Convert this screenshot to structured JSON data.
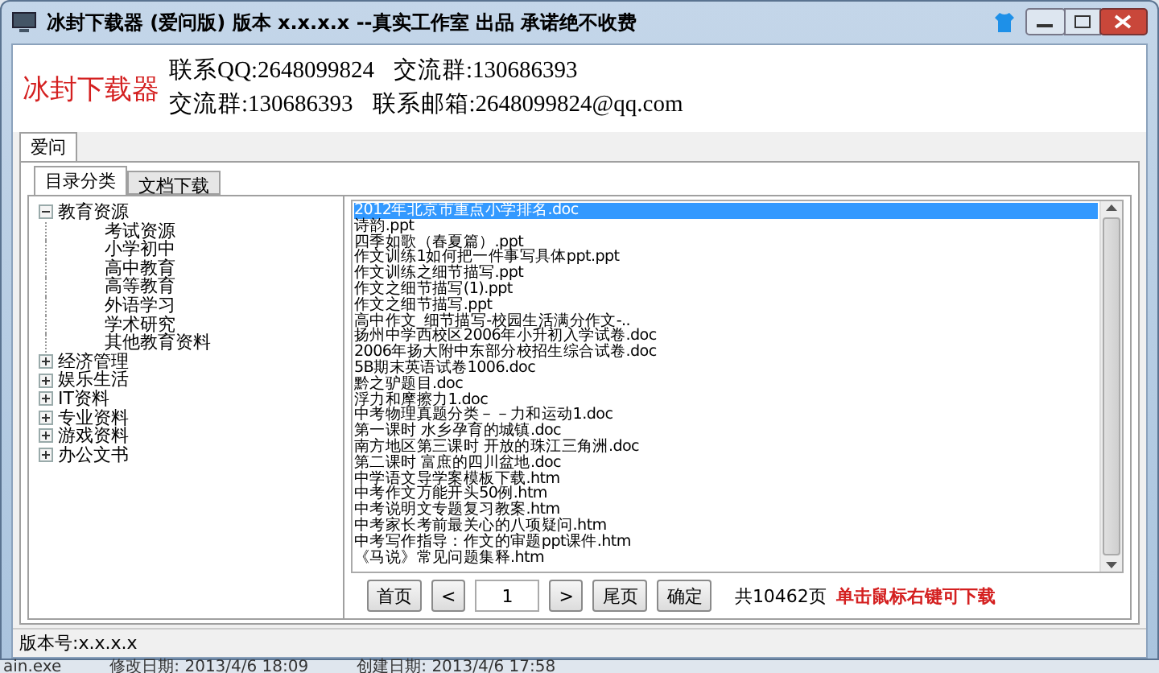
{
  "window": {
    "title": "冰封下载器 (爱问版)  版本 x.x.x.x --真实工作室 出品  承诺绝不收费"
  },
  "header": {
    "brand": "冰封下载器",
    "lines": [
      [
        "联系QQ:2648099824",
        "交流群:130686393"
      ],
      [
        "交流群:130686393",
        "联系邮箱:2648099824@qq.com"
      ]
    ]
  },
  "outer_tabs": [
    {
      "label": "爱问",
      "selected": true
    }
  ],
  "inner_tabs": [
    {
      "label": "目录分类",
      "selected": true
    },
    {
      "label": "文档下载",
      "selected": false
    }
  ],
  "tree": [
    {
      "label": "教育资源",
      "expanded": true,
      "children": [
        {
          "label": "考试资源"
        },
        {
          "label": "小学初中"
        },
        {
          "label": "高中教育"
        },
        {
          "label": "高等教育"
        },
        {
          "label": "外语学习"
        },
        {
          "label": "学术研究"
        },
        {
          "label": "其他教育资料"
        }
      ]
    },
    {
      "label": "经济管理",
      "expanded": false
    },
    {
      "label": "娱乐生活",
      "expanded": false
    },
    {
      "label": "IT资料",
      "expanded": false
    },
    {
      "label": "专业资料",
      "expanded": false
    },
    {
      "label": "游戏资料",
      "expanded": false
    },
    {
      "label": "办公文书",
      "expanded": false
    }
  ],
  "files": [
    {
      "name": "2012年北京市重点小学排名.doc",
      "selected": true
    },
    {
      "name": "诗韵.ppt",
      "selected": false
    },
    {
      "name": "四季如歌（春夏篇）.ppt",
      "selected": false
    },
    {
      "name": "作文训练1如何把一件事写具体ppt.ppt",
      "selected": false
    },
    {
      "name": "作文训练之细节描写.ppt",
      "selected": false
    },
    {
      "name": "作文之细节描写(1).ppt",
      "selected": false
    },
    {
      "name": "作文之细节描写.ppt",
      "selected": false
    },
    {
      "name": "高中作文_细节描写-校园生活满分作文-..",
      "selected": false
    },
    {
      "name": "扬州中学西校区2006年小升初入学试卷.doc",
      "selected": false
    },
    {
      "name": "2006年扬大附中东部分校招生综合试卷.doc",
      "selected": false
    },
    {
      "name": "5B期末英语试卷1006.doc",
      "selected": false
    },
    {
      "name": "黔之驴题目.doc",
      "selected": false
    },
    {
      "name": "浮力和摩擦力1.doc",
      "selected": false
    },
    {
      "name": "中考物理真题分类－－力和运动1.doc",
      "selected": false
    },
    {
      "name": "第一课时  水乡孕育的城镇.doc",
      "selected": false
    },
    {
      "name": "南方地区第三课时  开放的珠江三角洲.doc",
      "selected": false
    },
    {
      "name": "第二课时  富庶的四川盆地.doc",
      "selected": false
    },
    {
      "name": "中学语文导学案模板下载.htm",
      "selected": false
    },
    {
      "name": "中考作文万能开头50例.htm",
      "selected": false
    },
    {
      "name": "中考说明文专题复习教案.htm",
      "selected": false
    },
    {
      "name": "中考家长考前最关心的八项疑问.htm",
      "selected": false
    },
    {
      "name": "中考写作指导：作文的审题ppt课件.htm",
      "selected": false
    },
    {
      "name": "《马说》常见问题集释.htm",
      "selected": false
    }
  ],
  "pager": {
    "first": "首页",
    "prev": "<",
    "page": "1",
    "next": ">",
    "last": "尾页",
    "go": "确定",
    "total": "共10462页",
    "hint": "单击鼠标右键可下载"
  },
  "status_bar": "版本号:x.x.x.x",
  "background_strip": [
    "ain.exe",
    "修改日期: 2013/4/6 18:09",
    "创建日期: 2013/4/6 17:58"
  ]
}
